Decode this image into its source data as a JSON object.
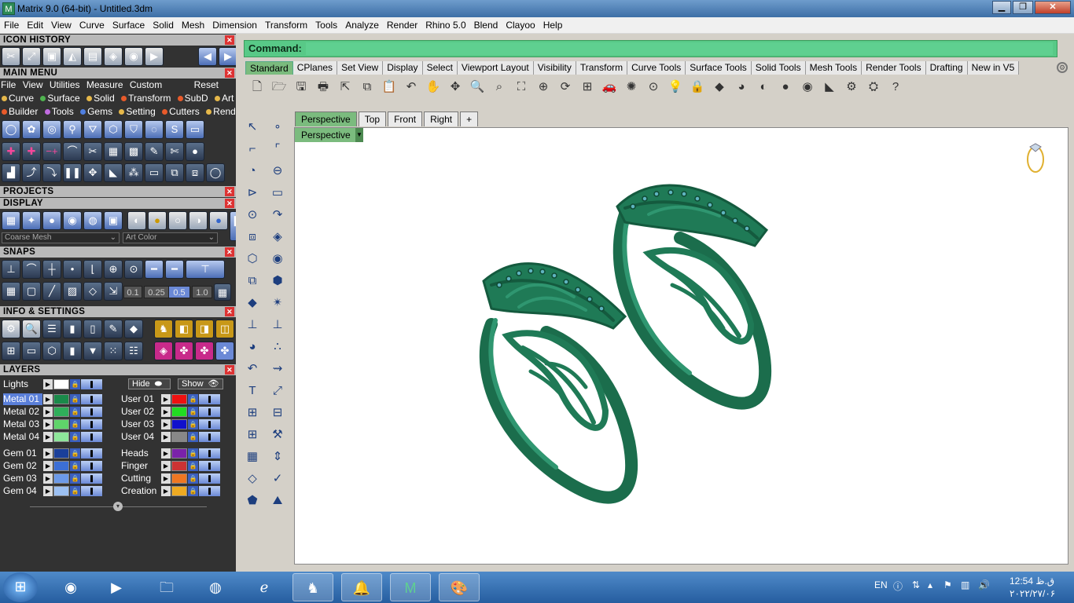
{
  "window": {
    "title": "Matrix 9.0 (64-bit) - Untitled.3dm",
    "app_icon": "matrix-logo"
  },
  "menubar": [
    "File",
    "Edit",
    "View",
    "Curve",
    "Surface",
    "Solid",
    "Mesh",
    "Dimension",
    "Transform",
    "Tools",
    "Analyze",
    "Render",
    "Rhino 5.0",
    "Blend",
    "Clayoo",
    "Help"
  ],
  "panels": {
    "icon_history": "ICON HISTORY",
    "main_menu": "MAIN MENU",
    "main_menu_bar": {
      "file": "File",
      "view": "View",
      "utilities": "Utilities",
      "measure": "Measure",
      "custom": "Custom",
      "reset": "Reset"
    },
    "main_menu_items_row1": [
      {
        "label": "Curve",
        "color": "#e6b84a"
      },
      {
        "label": "Surface",
        "color": "#4fb34f"
      },
      {
        "label": "Solid",
        "color": "#e6b84a"
      },
      {
        "label": "Transform",
        "color": "#e85a2a"
      },
      {
        "label": "SubD",
        "color": "#e85a2a"
      },
      {
        "label": "Art",
        "color": "#e6b84a"
      }
    ],
    "main_menu_items_row2": [
      {
        "label": "Builder",
        "color": "#e85a2a"
      },
      {
        "label": "Tools",
        "color": "#c06be0"
      },
      {
        "label": "Gems",
        "color": "#4f7fe0"
      },
      {
        "label": "Setting",
        "color": "#e6b84a"
      },
      {
        "label": "Cutters",
        "color": "#e85a2a"
      },
      {
        "label": "Render",
        "color": "#e6b84a"
      }
    ],
    "projects": "PROJECTS",
    "display": "DISPLAY",
    "display_mesh_select": "Coarse Mesh",
    "display_color_select": "Art Color",
    "snaps": "SNAPS",
    "snap_values": [
      "0.1",
      "0.25",
      "0.5",
      "1.0"
    ],
    "info_settings": "INFO & SETTINGS",
    "layers": "LAYERS",
    "layers_hide": "Hide",
    "layers_show": "Show",
    "layers_lights": "Lights",
    "layers_left": [
      {
        "name": "Metal 01",
        "color": "#1a8a4a",
        "selected": true
      },
      {
        "name": "Metal 02",
        "color": "#2fae5a",
        "selected": false
      },
      {
        "name": "Metal 03",
        "color": "#5fd46a",
        "selected": false
      },
      {
        "name": "Metal 04",
        "color": "#8ee69a",
        "selected": false
      },
      {
        "name": "Gem 01",
        "color": "#1a3f9a",
        "selected": false
      },
      {
        "name": "Gem 02",
        "color": "#3c6fd6",
        "selected": false
      },
      {
        "name": "Gem 03",
        "color": "#6c9ae8",
        "selected": false
      },
      {
        "name": "Gem 04",
        "color": "#9cc0f2",
        "selected": false
      }
    ],
    "layers_right": [
      {
        "name": "User 01",
        "color": "#ee1111"
      },
      {
        "name": "User 02",
        "color": "#22dd22"
      },
      {
        "name": "User 03",
        "color": "#1111cc"
      },
      {
        "name": "User 04",
        "color": "#888888"
      },
      {
        "name": "Heads",
        "color": "#7a22aa"
      },
      {
        "name": "Finger",
        "color": "#cc3333"
      },
      {
        "name": "Cutting",
        "color": "#ee7722"
      },
      {
        "name": "Creation",
        "color": "#eeaa22"
      }
    ]
  },
  "command": {
    "label": "Command:",
    "value": ""
  },
  "toolbar_tabs": [
    "Standard",
    "CPlanes",
    "Set View",
    "Display",
    "Select",
    "Viewport Layout",
    "Visibility",
    "Transform",
    "Curve Tools",
    "Surface Tools",
    "Solid Tools",
    "Mesh Tools",
    "Render Tools",
    "Drafting",
    "New in V5"
  ],
  "active_toolbar_tab": "Standard",
  "standard_tools": [
    "new-file",
    "open",
    "save",
    "print",
    "import",
    "copy",
    "paste",
    "undo",
    "pan",
    "move",
    "zoom",
    "zoom-window",
    "zoom-extents",
    "zoom-selected",
    "rotate-view",
    "four-views",
    "car",
    "lights-off",
    "grid",
    "bulb",
    "lock",
    "layer-color",
    "render",
    "material",
    "sphere-shaded",
    "sphere-rendered",
    "dimension",
    "properties",
    "options",
    "help"
  ],
  "viewport_tabs": [
    "Perspective",
    "Top",
    "Front",
    "Right",
    "+"
  ],
  "active_viewport": "Perspective",
  "viewport_label": "Perspective",
  "accent": "#7bbb7e",
  "ring_color": "#1f7a56",
  "taskbar": {
    "apps": [
      "windows-start",
      "chrome",
      "media-player",
      "file-explorer",
      "firefox",
      "internet-explorer",
      "rhino",
      "notifications",
      "matrix",
      "paint"
    ],
    "language": "EN",
    "time": "12:54 ق.ظ",
    "date": "۲۰۲۲/۲۷/۰۶"
  }
}
